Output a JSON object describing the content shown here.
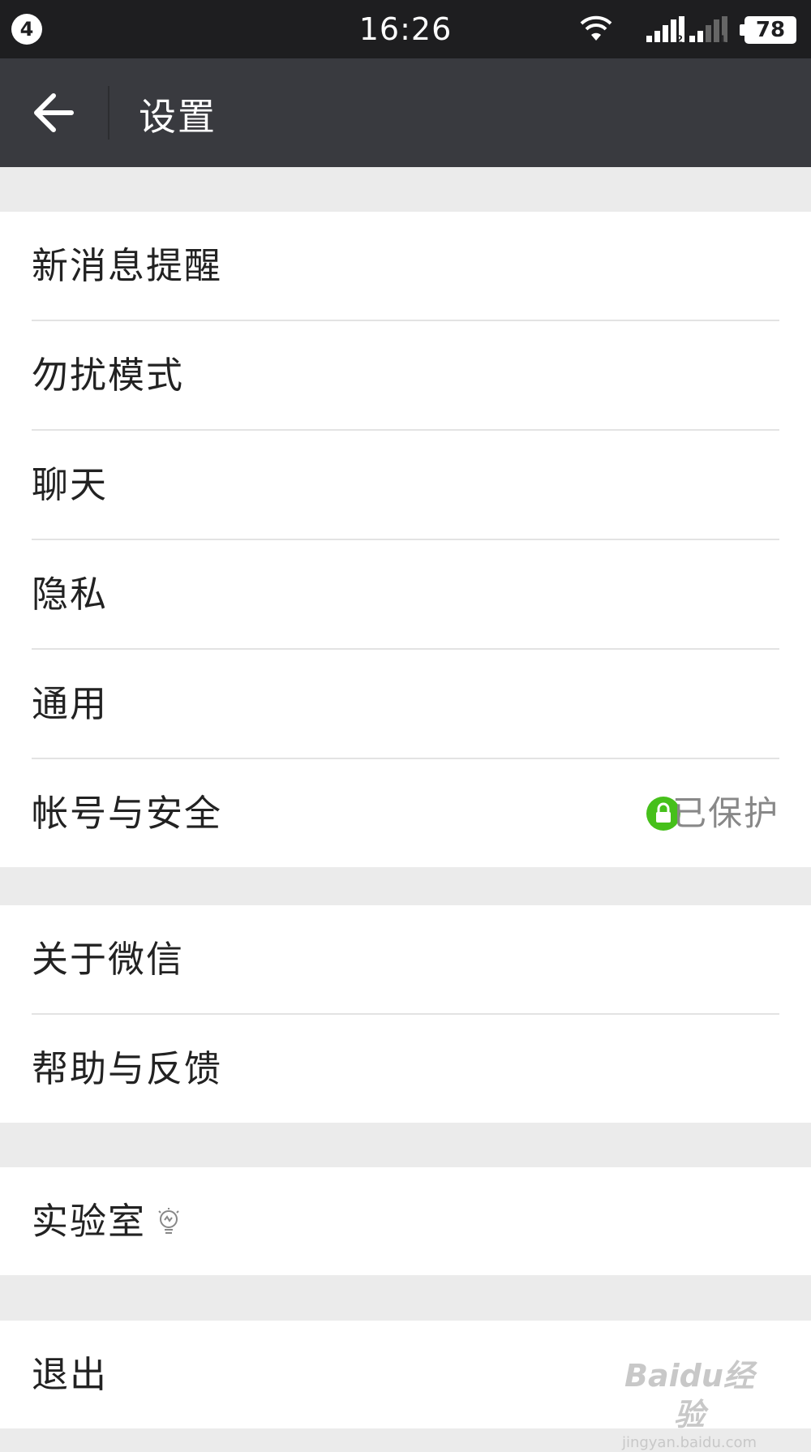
{
  "status_bar": {
    "notification_count": "4",
    "time": "16:26",
    "sim1_label": "2",
    "sim2_label": "1",
    "battery": "78"
  },
  "header": {
    "title": "设置",
    "back_icon": "arrow-left-icon"
  },
  "groups": [
    {
      "items": [
        {
          "label": "新消息提醒"
        },
        {
          "label": "勿扰模式"
        },
        {
          "label": "聊天"
        },
        {
          "label": "隐私"
        },
        {
          "label": "通用"
        },
        {
          "label": "帐号与安全",
          "status": "已保护",
          "status_icon": "lock-icon",
          "status_color": "#46c01b"
        }
      ]
    },
    {
      "items": [
        {
          "label": "关于微信"
        },
        {
          "label": "帮助与反馈"
        }
      ]
    },
    {
      "items": [
        {
          "label": "实验室",
          "icon": "lightbulb-icon"
        }
      ]
    },
    {
      "items": [
        {
          "label": "退出"
        }
      ]
    }
  ],
  "watermark": {
    "logo": "Baidu经验",
    "url": "jingyan.baidu.com"
  },
  "colors": {
    "status_bar_bg": "#1e1e20",
    "action_bar_bg": "#393a3f",
    "page_bg": "#ebebeb",
    "accent_green": "#46c01b"
  }
}
